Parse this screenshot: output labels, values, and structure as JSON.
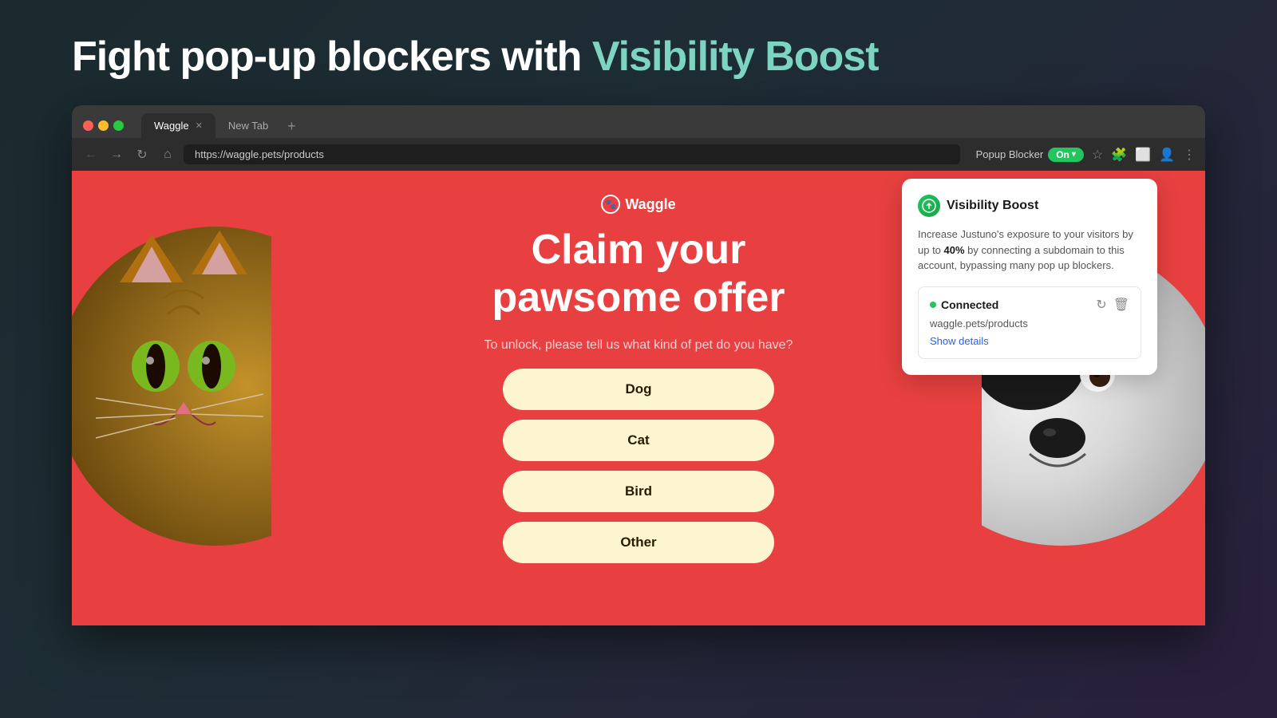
{
  "page": {
    "title_part1": "Fight pop-up blockers with ",
    "title_highlight": "Visibility Boost",
    "background_color": "#1a2a2e"
  },
  "browser": {
    "tabs": [
      {
        "label": "Waggle",
        "active": true
      },
      {
        "label": "New Tab",
        "active": false
      }
    ],
    "url": "https://waggle.pets/products",
    "nav": {
      "back": "←",
      "forward": "→",
      "reload": "↻",
      "home": "⌂"
    },
    "popup_blocker_label": "Popup Blocker",
    "popup_blocker_status": "On"
  },
  "website": {
    "logo": "Waggle",
    "headline_line1": "Claim your",
    "headline_line2": "pawsome offer",
    "subtext": "To unlock, please tell us what kind of pet do you have?",
    "buttons": [
      {
        "label": "Dog"
      },
      {
        "label": "Cat"
      },
      {
        "label": "Bird"
      },
      {
        "label": "Other"
      }
    ]
  },
  "visibility_boost": {
    "title": "Visibility Boost",
    "description_pre": "Increase Justuno's exposure to your visitors by up to ",
    "description_bold": "40%",
    "description_post": " by connecting a subdomain to this account, bypassing many pop up blockers.",
    "status_label": "Connected",
    "status_url": "waggle.pets/products",
    "show_details_label": "Show details"
  }
}
